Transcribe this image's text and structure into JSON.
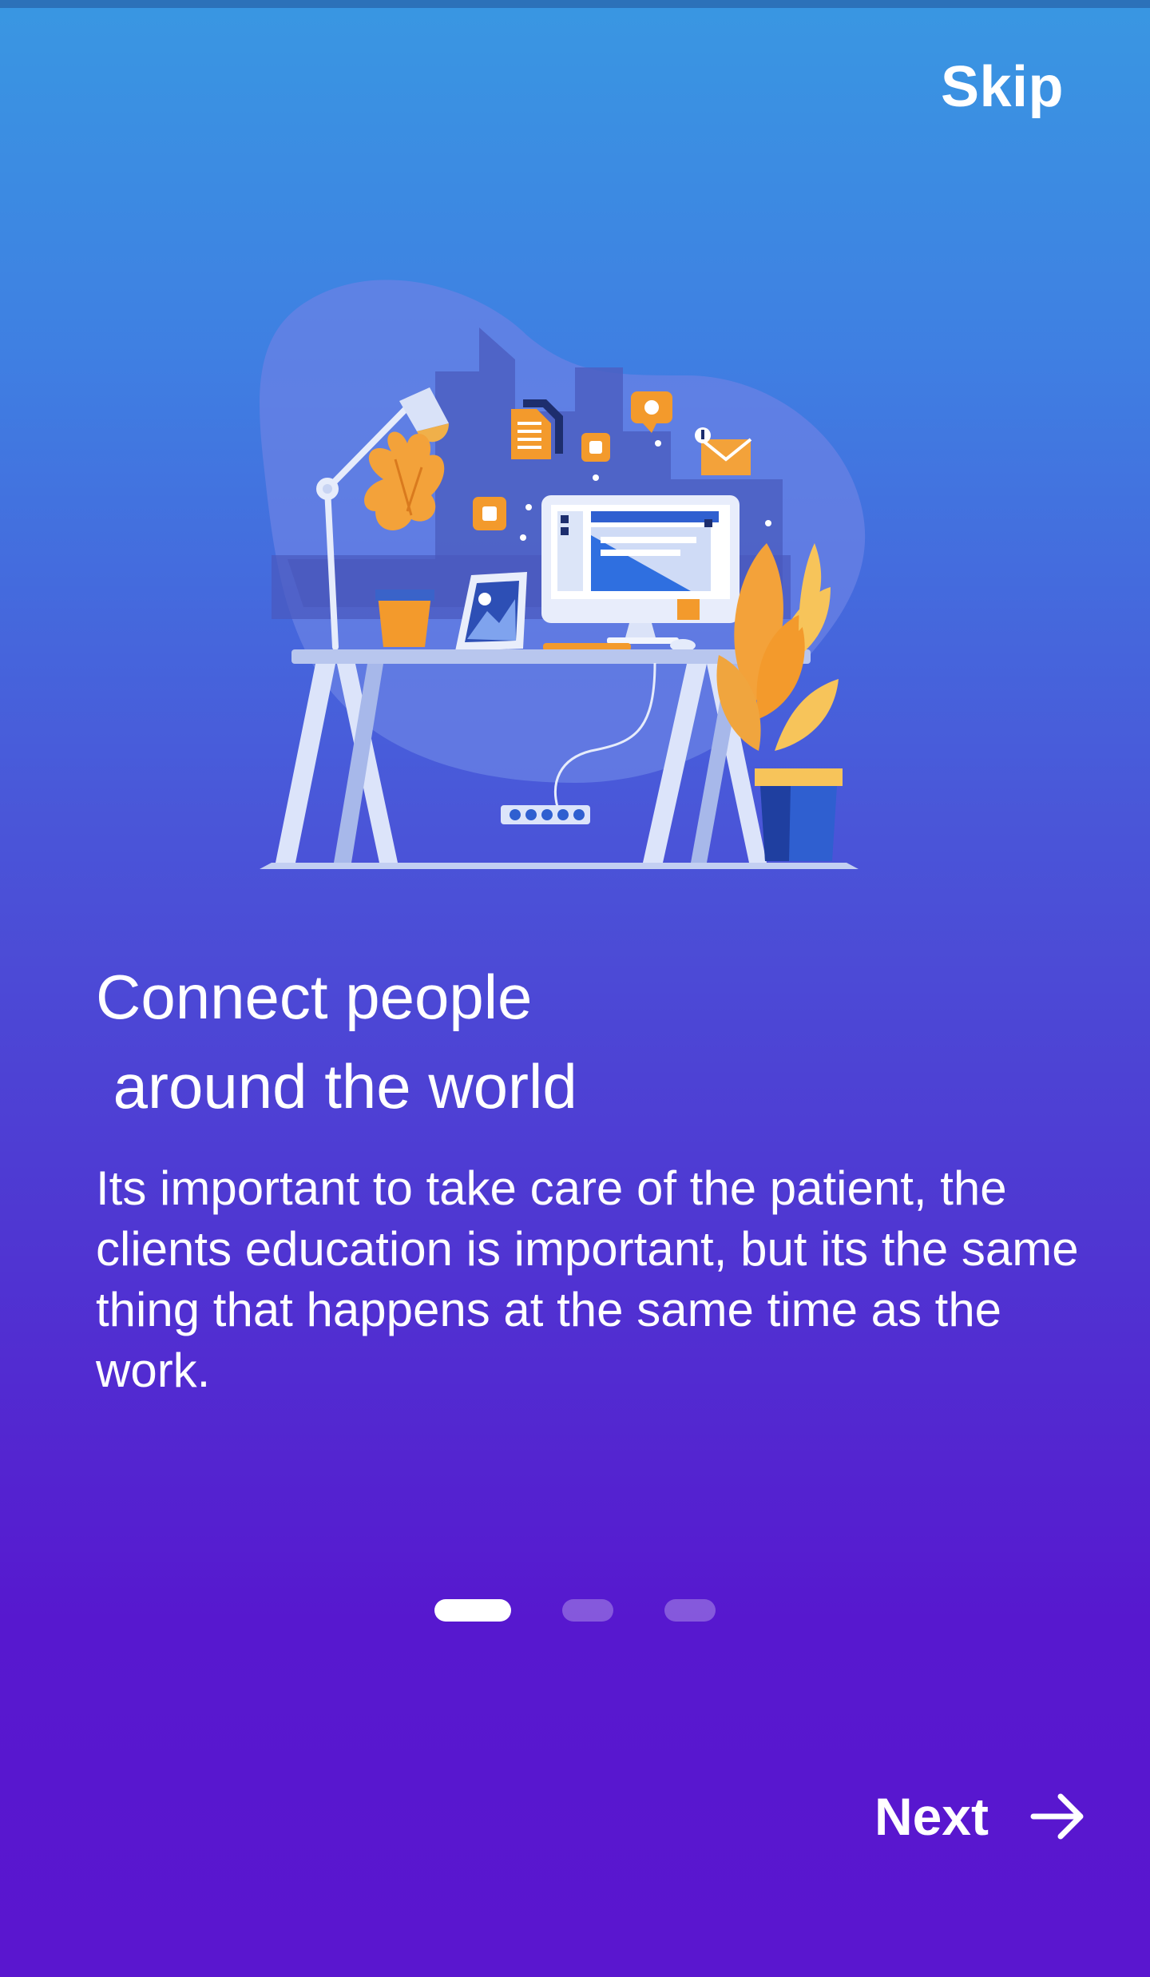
{
  "header": {
    "skip_label": "Skip"
  },
  "illustration": {
    "icon": "desk-workspace-illustration"
  },
  "content": {
    "title": "Connect people\n around the world",
    "description": "Its important to take care of the patient, the clients education is important, but its the same thing that happens at the same time as the work."
  },
  "pager": {
    "total": 3,
    "active_index": 0
  },
  "footer": {
    "next_label": "Next",
    "next_icon": "arrow-right-icon"
  },
  "colors": {
    "gradient_top": "#3997e2",
    "gradient_bottom": "#5a16cf",
    "accent_orange": "#f39a2c",
    "text": "#ffffff"
  }
}
